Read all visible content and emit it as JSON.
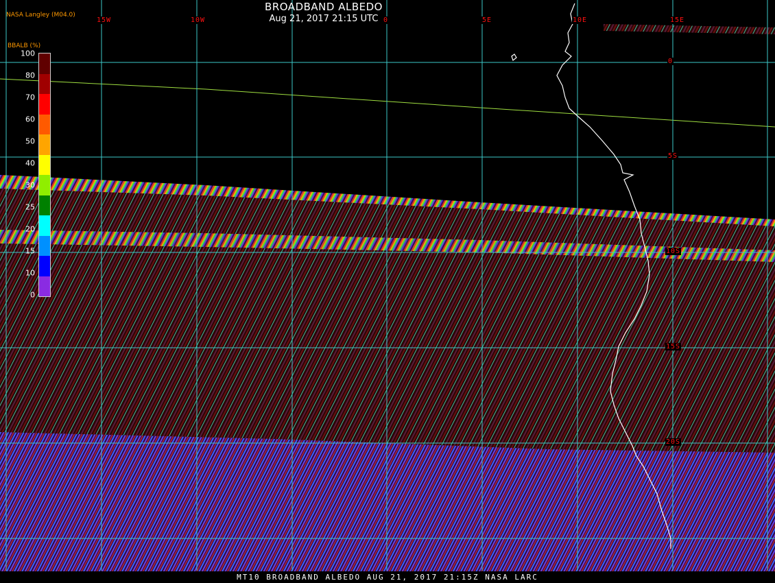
{
  "header": {
    "title": "BROADBAND ALBEDO",
    "subtitle": "Aug 21, 2017 21:15 UTC",
    "credit": "NASA Langley (M04.0)"
  },
  "legend": {
    "title": "BBALB (%)",
    "ticks": [
      "100",
      "80",
      "70",
      "60",
      "50",
      "40",
      "30",
      "25",
      "20",
      "15",
      "10",
      "0"
    ],
    "colors": [
      "#600000",
      "#a00000",
      "#ff0000",
      "#ff5a00",
      "#ffa500",
      "#ffff00",
      "#90ee00",
      "#008000",
      "#00ffff",
      "#0090ff",
      "#0000ff",
      "#8a2be2"
    ]
  },
  "grid": {
    "lon_labels": [
      "15W",
      "10W",
      "0",
      "5E",
      "10E",
      "15E"
    ],
    "lat_labels": [
      "0",
      "5S",
      "10S",
      "15S",
      "20S"
    ],
    "color": "#3cc8c8"
  },
  "map": {
    "background": "#000000",
    "coastline_color": "#ffffff",
    "label_color": "#ff1010"
  },
  "footer": {
    "text": "MT10  BROADBAND ALBEDO   AUG 21, 2017 21:15Z   NASA LARC"
  }
}
